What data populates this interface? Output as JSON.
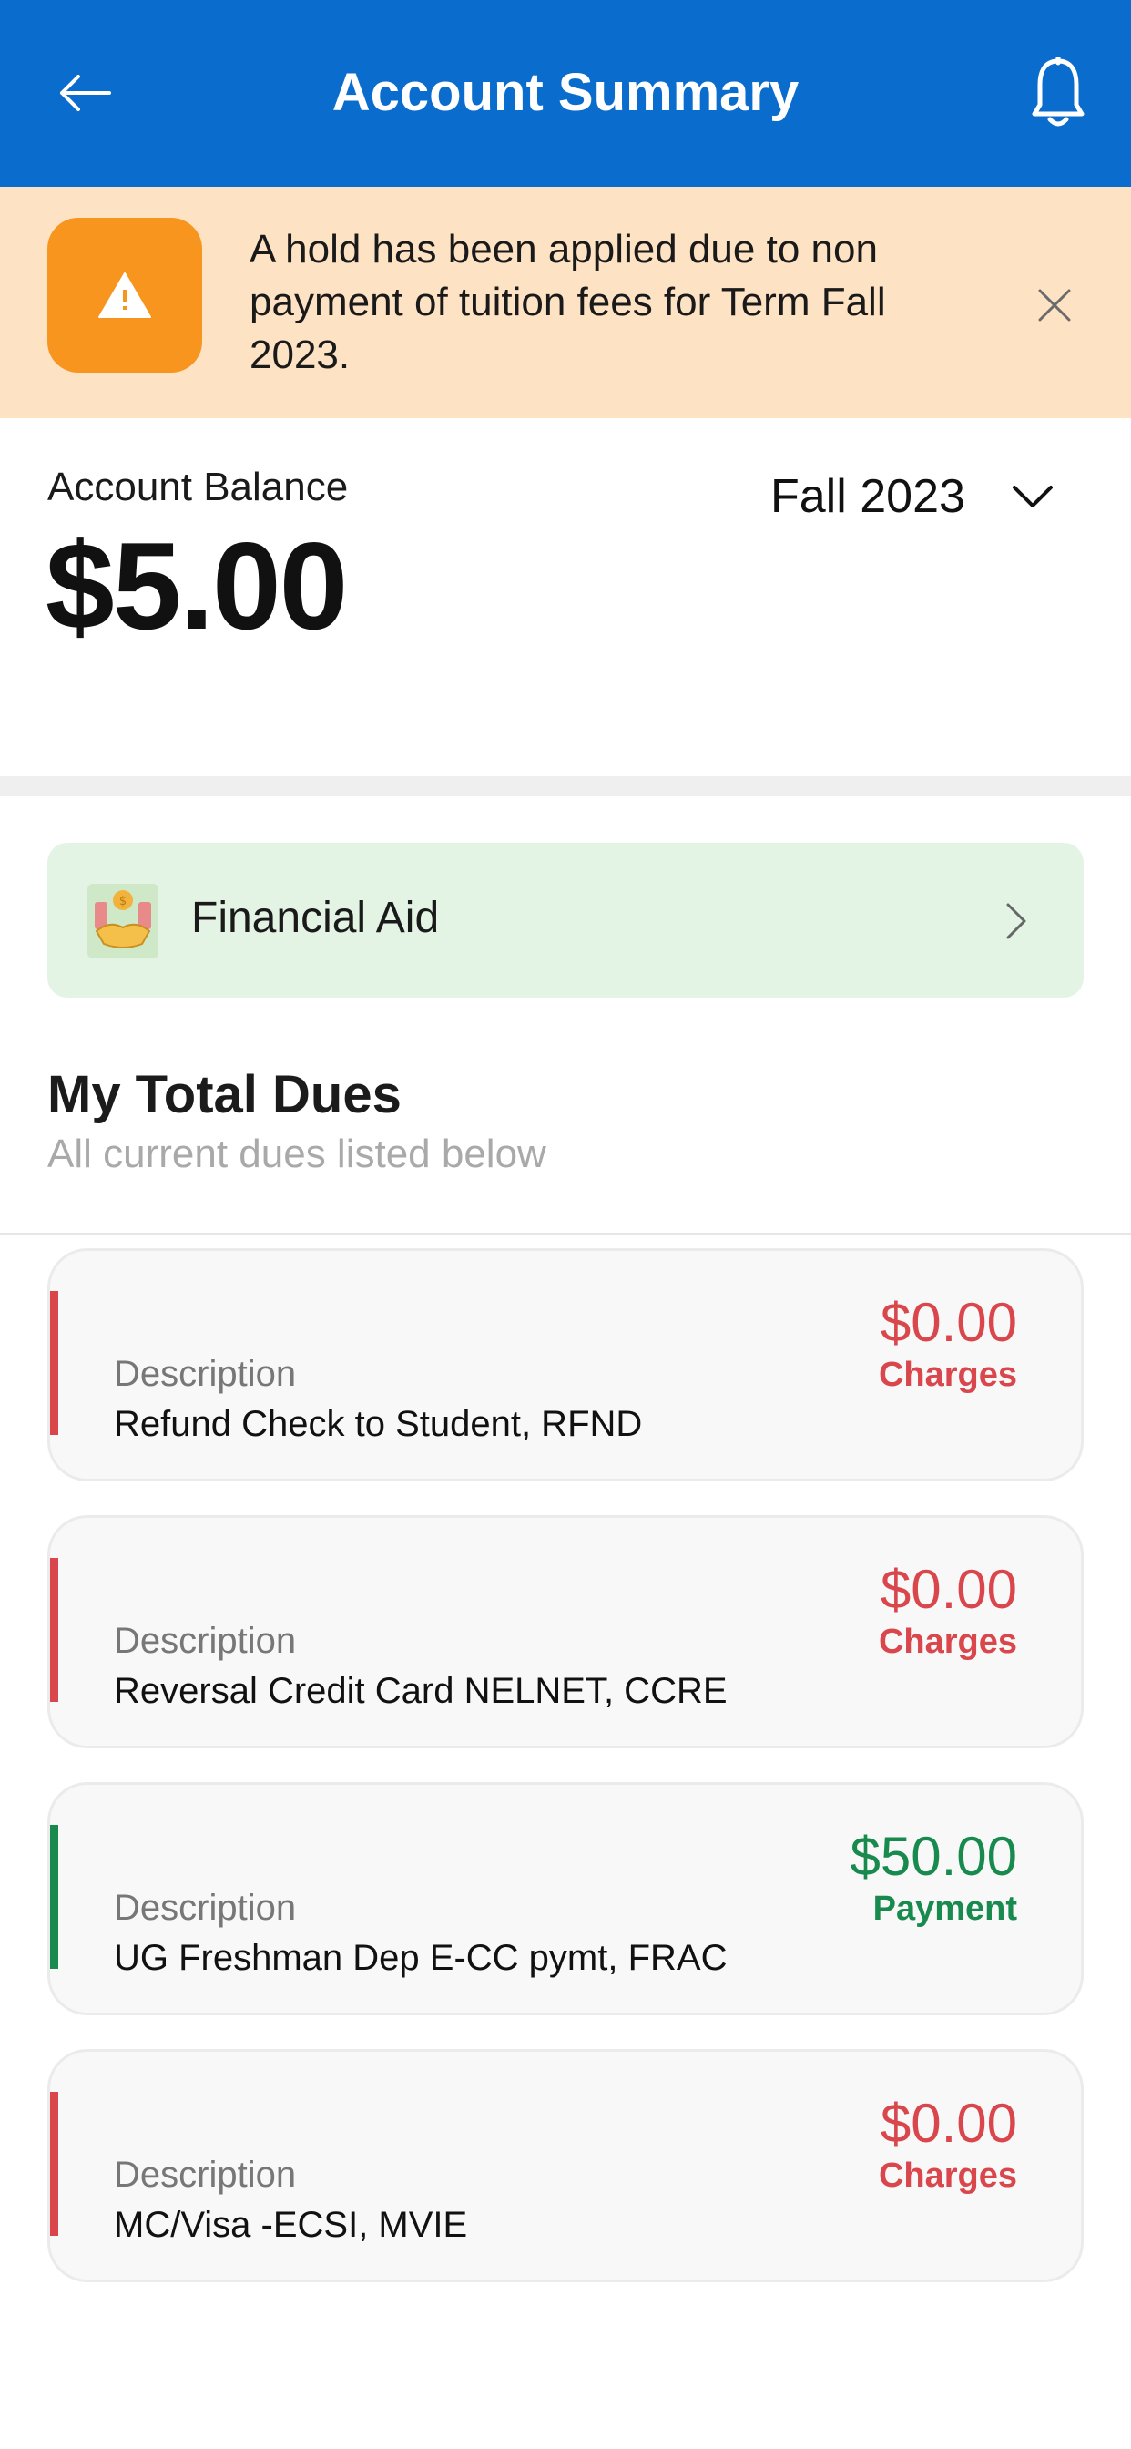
{
  "header": {
    "title": "Account Summary",
    "back_icon": "arrow-left-icon",
    "bell_icon": "bell-icon",
    "background": "#0a6ccc"
  },
  "hold_banner": {
    "message": "A hold has been applied due to non payment of tuition fees for Term Fall 2023.",
    "icon": "warning-icon",
    "close_icon": "close-icon",
    "background": "#fde2c4",
    "icon_background": "#f7951f"
  },
  "balance": {
    "label": "Account Balance",
    "amount": "$5.00"
  },
  "term_select": {
    "value": "Fall 2023",
    "chevron_icon": "chevron-down-icon"
  },
  "financial_aid": {
    "label": "Financial Aid",
    "icon": "handshake-icon",
    "chevron_icon": "chevron-right-icon",
    "background": "#e3f4e4"
  },
  "dues": {
    "title": "My Total Dues",
    "subtitle": "All current dues listed below",
    "items": [
      {
        "desc_label": "Description",
        "description": "Refund Check to Student, RFND",
        "amount": "$0.00",
        "type": "Charges",
        "color": "#d9474d"
      },
      {
        "desc_label": "Description",
        "description": "Reversal Credit Card NELNET, CCRE",
        "amount": "$0.00",
        "type": "Charges",
        "color": "#d9474d"
      },
      {
        "desc_label": "Description",
        "description": "UG Freshman Dep E-CC pymt, FRAC",
        "amount": "$50.00",
        "type": "Payment",
        "color": "#198a4e"
      },
      {
        "desc_label": "Description",
        "description": "MC/Visa -ECSI, MVIE",
        "amount": "$0.00",
        "type": "Charges",
        "color": "#d9474d"
      }
    ]
  }
}
